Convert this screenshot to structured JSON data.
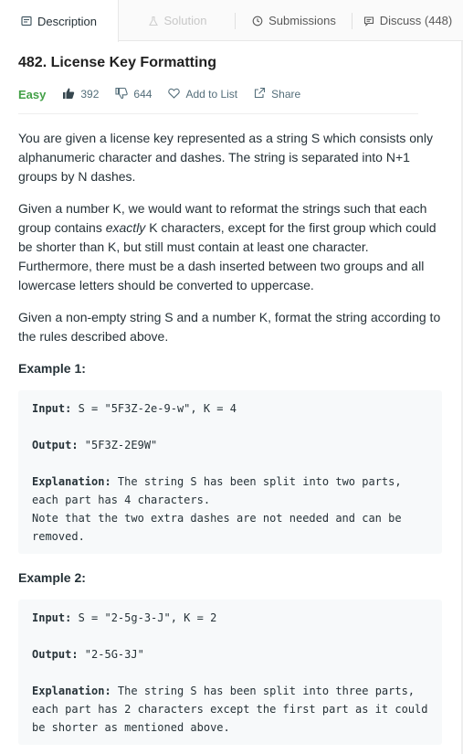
{
  "tabs": [
    {
      "label": "Description",
      "icon": "description-icon",
      "active": true
    },
    {
      "label": "Solution",
      "icon": "flask-icon",
      "disabled": true
    },
    {
      "label": "Submissions",
      "icon": "clock-icon"
    },
    {
      "label": "Discuss (448)",
      "icon": "chat-icon"
    }
  ],
  "problem": {
    "title": "482. License Key Formatting",
    "difficulty": "Easy",
    "likes": "392",
    "dislikes": "644",
    "add_to_list": "Add to List",
    "share": "Share"
  },
  "description": {
    "p1": "You are given a license key represented as a string S which consists only alphanumeric character and dashes. The string is separated into N+1 groups by N dashes.",
    "p2_before": "Given a number K, we would want to reformat the strings such that each group contains ",
    "p2_em": "exactly",
    "p2_after": " K characters, except for the first group which could be shorter than K, but still must contain at least one character. Furthermore, there must be a dash inserted between two groups and all lowercase letters should be converted to uppercase.",
    "p3": "Given a non-empty string S and a number K, format the string according to the rules described above."
  },
  "examples": [
    {
      "title": "Example 1:",
      "input_label": "Input:",
      "input": " S = \"5F3Z-2e-9-w\", K = 4",
      "output_label": "Output:",
      "output": " \"5F3Z-2E9W\"",
      "explanation_label": "Explanation:",
      "explanation_lines": [
        " The string S has been split into two parts,",
        "each part has 4 characters.",
        "Note that the two extra dashes are not needed and can be",
        "removed."
      ]
    },
    {
      "title": "Example 2:",
      "input_label": "Input:",
      "input": " S = \"2-5g-3-J\", K = 2",
      "output_label": "Output:",
      "output": " \"2-5G-3J\"",
      "explanation_label": "Explanation:",
      "explanation_lines": [
        " The string S has been split into three parts,",
        "each part has 2 characters except the first part as it could",
        "be shorter as mentioned above."
      ]
    }
  ],
  "colors": {
    "easy": "#43a047",
    "meta": "#546e7a",
    "code_bg": "#f7f9fa"
  }
}
